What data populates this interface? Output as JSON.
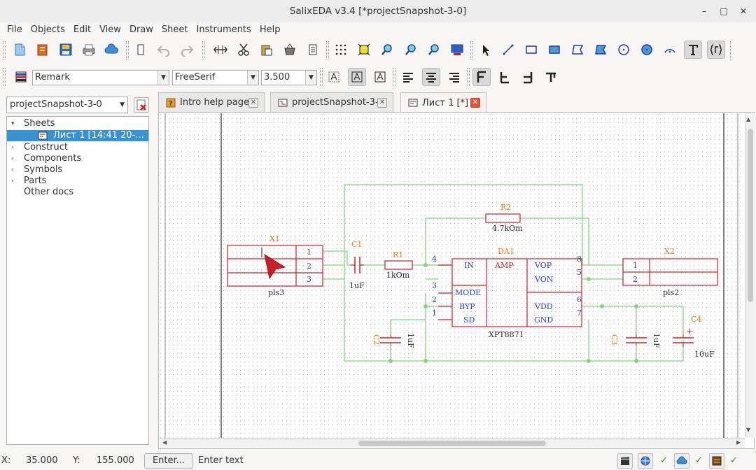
{
  "window": {
    "title": "SalixEDA v3.4 [*projectSnapshot-3-0]",
    "minimize": "–",
    "maximize": "□",
    "close": "✕"
  },
  "menu": [
    "File",
    "Objects",
    "Edit",
    "View",
    "Draw",
    "Sheet",
    "Instruments",
    "Help"
  ],
  "format_toolbar": {
    "style_value": "Remark",
    "font_value": "FreeSerif",
    "size_value": "3.500"
  },
  "project": {
    "selected": "projectSnapshot-3-0"
  },
  "tree": {
    "items": [
      {
        "label": "Sheets",
        "expander": "▾"
      },
      {
        "label": "Лист 1 [14:41 20-...",
        "selected": true
      },
      {
        "label": "Construct",
        "expander": "›"
      },
      {
        "label": "Components",
        "expander": "›"
      },
      {
        "label": "Symbols",
        "expander": "›"
      },
      {
        "label": "Parts",
        "expander": "›"
      },
      {
        "label": "Other docs"
      }
    ]
  },
  "tabs": [
    {
      "label": "Intro help page",
      "close": "✕"
    },
    {
      "label": "projectSnapshot-3-0",
      "close": "✕"
    },
    {
      "label": "Лист 1 [*]",
      "close": "✕",
      "active": true
    }
  ],
  "schematic": {
    "colors": {
      "component": "#c8202a",
      "wire": "#7fd67f",
      "pin_number": "#2c3fbf",
      "ref": "#e07a1a",
      "text": "#2b2b2b"
    },
    "x1": {
      "ref": "X1",
      "pins": [
        "1",
        "2",
        "3"
      ],
      "name": "pls3"
    },
    "x2": {
      "ref": "X2",
      "pins": [
        "1",
        "2"
      ],
      "name": "pls2"
    },
    "c1": {
      "ref": "C1",
      "value": "1uF"
    },
    "r1": {
      "ref": "R1",
      "value": "1kOm"
    },
    "r2": {
      "ref": "R2",
      "value": "4.7kOm"
    },
    "c2": {
      "ref": "C2",
      "value": "1uF"
    },
    "c3": {
      "ref": "C3",
      "value": "1uF"
    },
    "c4": {
      "ref": "C4",
      "value": "10uF",
      "plus": "+"
    },
    "da1": {
      "ref": "DA1",
      "name": "XPT8871",
      "amp": "AMP",
      "left_pins": [
        {
          "num": "4",
          "name": "IN"
        },
        {
          "num": "3",
          "name": "MODE"
        },
        {
          "num": "2",
          "name": "BYP"
        },
        {
          "num": "1",
          "name": "SD"
        }
      ],
      "right_pins": [
        {
          "num": "8",
          "name": "VOP"
        },
        {
          "num": "5",
          "name": "VON"
        },
        {
          "num": "6",
          "name": "VDD"
        },
        {
          "num": "7",
          "name": "GND"
        }
      ]
    }
  },
  "status": {
    "x_label": "X:",
    "x_value": "35.000",
    "y_label": "Y:",
    "y_value": "155.000",
    "enter_label": "Enter...",
    "hint": "Enter text",
    "checks": [
      "✓",
      "✓",
      "✓"
    ]
  }
}
